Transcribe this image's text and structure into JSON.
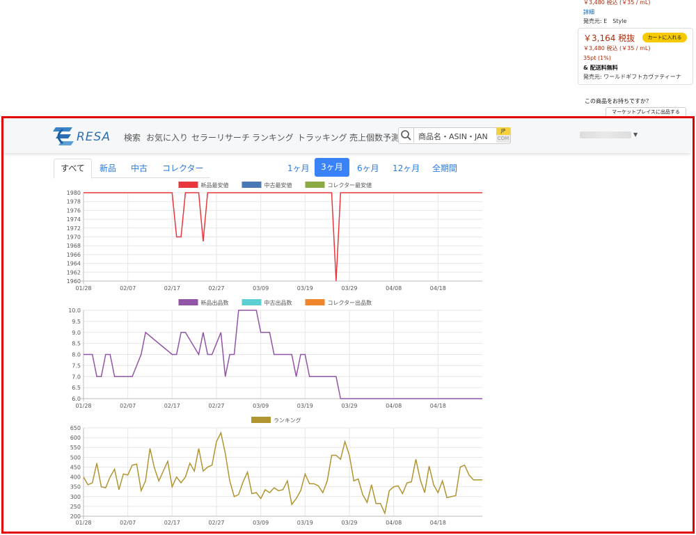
{
  "amazon_panel": {
    "top_price_line": "￥3,480 税込 (￥35 / mL)",
    "details_link": "詳細",
    "seller_1": "発売元: E　Style",
    "price_main": "￥3,164 税抜",
    "add_to_cart": "カートに入れる",
    "price_tax": "￥3,480 税込 (￥35 / mL)",
    "points": "35pt (1%)",
    "shipping": "& 配送料無料",
    "seller_2": "発売元: ワールドギフトカヴァティーナ",
    "have_item": "この商品をお持ちですか？",
    "marketplace_button": "マーケットプレイスに出品する"
  },
  "eresa_nav": {
    "logo_text": "RESA",
    "links": [
      "検索",
      "お気に入り",
      "セラーリサーチ",
      "ランキング",
      "トラッキング",
      "売上個数予測"
    ],
    "search_placeholder": "商品名・ASIN・JAN",
    "region_top": "JP",
    "region_bottom": "COM"
  },
  "tabs": {
    "condition": [
      "すべて",
      "新品",
      "中古",
      "コレクター"
    ],
    "active_condition": "すべて",
    "periods": [
      "1ヶ月",
      "3ヶ月",
      "6ヶ月",
      "12ヶ月",
      "全期間"
    ],
    "active_period": "3ヶ月"
  },
  "colors": {
    "accent": "#3a82f7",
    "frame": "#e00000",
    "new_price": "#e8363c",
    "used_price": "#4a78b5",
    "collector_price": "#8aab44",
    "new_count": "#9254a6",
    "used_count": "#5ccfd3",
    "collector_count": "#f0862c",
    "ranking": "#b09430"
  },
  "chart_data": [
    {
      "type": "line",
      "legend": [
        "新品最安値",
        "中古最安値",
        "コレクター最安値"
      ],
      "ylim": [
        1960,
        1980
      ],
      "yticks": [
        1960,
        1962,
        1964,
        1966,
        1968,
        1970,
        1972,
        1974,
        1976,
        1978,
        1980
      ],
      "xlim": [
        0,
        90
      ],
      "xtick_labels": [
        "01/28",
        "02/07",
        "02/17",
        "02/27",
        "03/09",
        "03/19",
        "03/29",
        "04/08",
        "04/18"
      ],
      "series": [
        {
          "name": "新品最安値",
          "x": [
            0,
            20,
            21,
            22,
            23,
            24,
            26,
            27,
            28,
            29,
            56,
            57,
            58,
            90
          ],
          "y": [
            1980,
            1980,
            1970,
            1970,
            1980,
            1980,
            1980,
            1969,
            1980,
            1980,
            1980,
            1960,
            1980,
            1980
          ]
        }
      ]
    },
    {
      "type": "line",
      "legend": [
        "新品出品数",
        "中古出品数",
        "コレクター出品数"
      ],
      "ylim": [
        6.0,
        10.0
      ],
      "yticks": [
        6.0,
        6.5,
        7.0,
        7.5,
        8.0,
        8.5,
        9.0,
        9.5,
        10.0
      ],
      "xlim": [
        0,
        90
      ],
      "xtick_labels": [
        "01/28",
        "02/07",
        "02/17",
        "02/27",
        "03/09",
        "03/19",
        "03/29",
        "04/08",
        "04/18"
      ],
      "series": [
        {
          "name": "新品出品数",
          "x": [
            0,
            2,
            3,
            4,
            5,
            6,
            7,
            11,
            13,
            14,
            20,
            21,
            22,
            23,
            26,
            27,
            28,
            29,
            31,
            32,
            33,
            34,
            35,
            36,
            39,
            40,
            42,
            43,
            46,
            47,
            48,
            49,
            50,
            51,
            52,
            57,
            58,
            90
          ],
          "y": [
            8,
            8,
            7,
            7,
            8,
            8,
            7,
            7,
            8,
            9,
            8,
            8,
            9,
            9,
            8,
            9,
            8,
            8,
            9,
            7,
            8,
            8,
            10,
            10,
            10,
            9,
            9,
            8,
            8,
            8,
            7,
            8,
            8,
            7,
            7,
            7,
            6,
            6
          ]
        }
      ]
    },
    {
      "type": "line",
      "legend": [
        "ランキング"
      ],
      "ylim": [
        200,
        650
      ],
      "yticks": [
        200,
        250,
        300,
        350,
        400,
        450,
        500,
        550,
        600,
        650
      ],
      "xlim": [
        0,
        90
      ],
      "xtick_labels": [
        "01/28",
        "02/07",
        "02/17",
        "02/27",
        "03/09",
        "03/19",
        "03/29",
        "04/08",
        "04/18"
      ],
      "series": [
        {
          "name": "ランキング",
          "x": [
            0,
            1,
            2,
            3,
            4,
            5,
            6,
            7,
            8,
            9,
            10,
            11,
            12,
            13,
            14,
            15,
            16,
            17,
            18,
            19,
            20,
            21,
            22,
            23,
            24,
            25,
            26,
            27,
            28,
            29,
            30,
            31,
            32,
            33,
            34,
            35,
            36,
            37,
            38,
            39,
            40,
            41,
            42,
            43,
            44,
            45,
            46,
            47,
            48,
            49,
            50,
            51,
            52,
            53,
            54,
            55,
            56,
            57,
            58,
            59,
            60,
            61,
            62,
            63,
            64,
            65,
            66,
            67,
            68,
            69,
            70,
            71,
            72,
            73,
            74,
            75,
            76,
            77,
            78,
            79,
            80,
            81,
            82,
            83,
            84,
            85,
            86,
            87,
            88,
            89,
            90
          ],
          "y": [
            400,
            360,
            370,
            470,
            350,
            345,
            400,
            440,
            335,
            415,
            410,
            460,
            465,
            330,
            380,
            545,
            445,
            380,
            430,
            480,
            350,
            400,
            370,
            400,
            470,
            430,
            545,
            430,
            450,
            460,
            580,
            625,
            520,
            380,
            300,
            310,
            375,
            425,
            315,
            320,
            290,
            335,
            320,
            345,
            330,
            335,
            380,
            260,
            290,
            330,
            415,
            365,
            365,
            355,
            320,
            380,
            510,
            510,
            490,
            580,
            510,
            380,
            390,
            310,
            270,
            360,
            265,
            265,
            215,
            330,
            350,
            355,
            315,
            370,
            375,
            490,
            385,
            320,
            455,
            360,
            320,
            380,
            295,
            300,
            305,
            450,
            460,
            410,
            385,
            385,
            385
          ]
        }
      ]
    }
  ]
}
